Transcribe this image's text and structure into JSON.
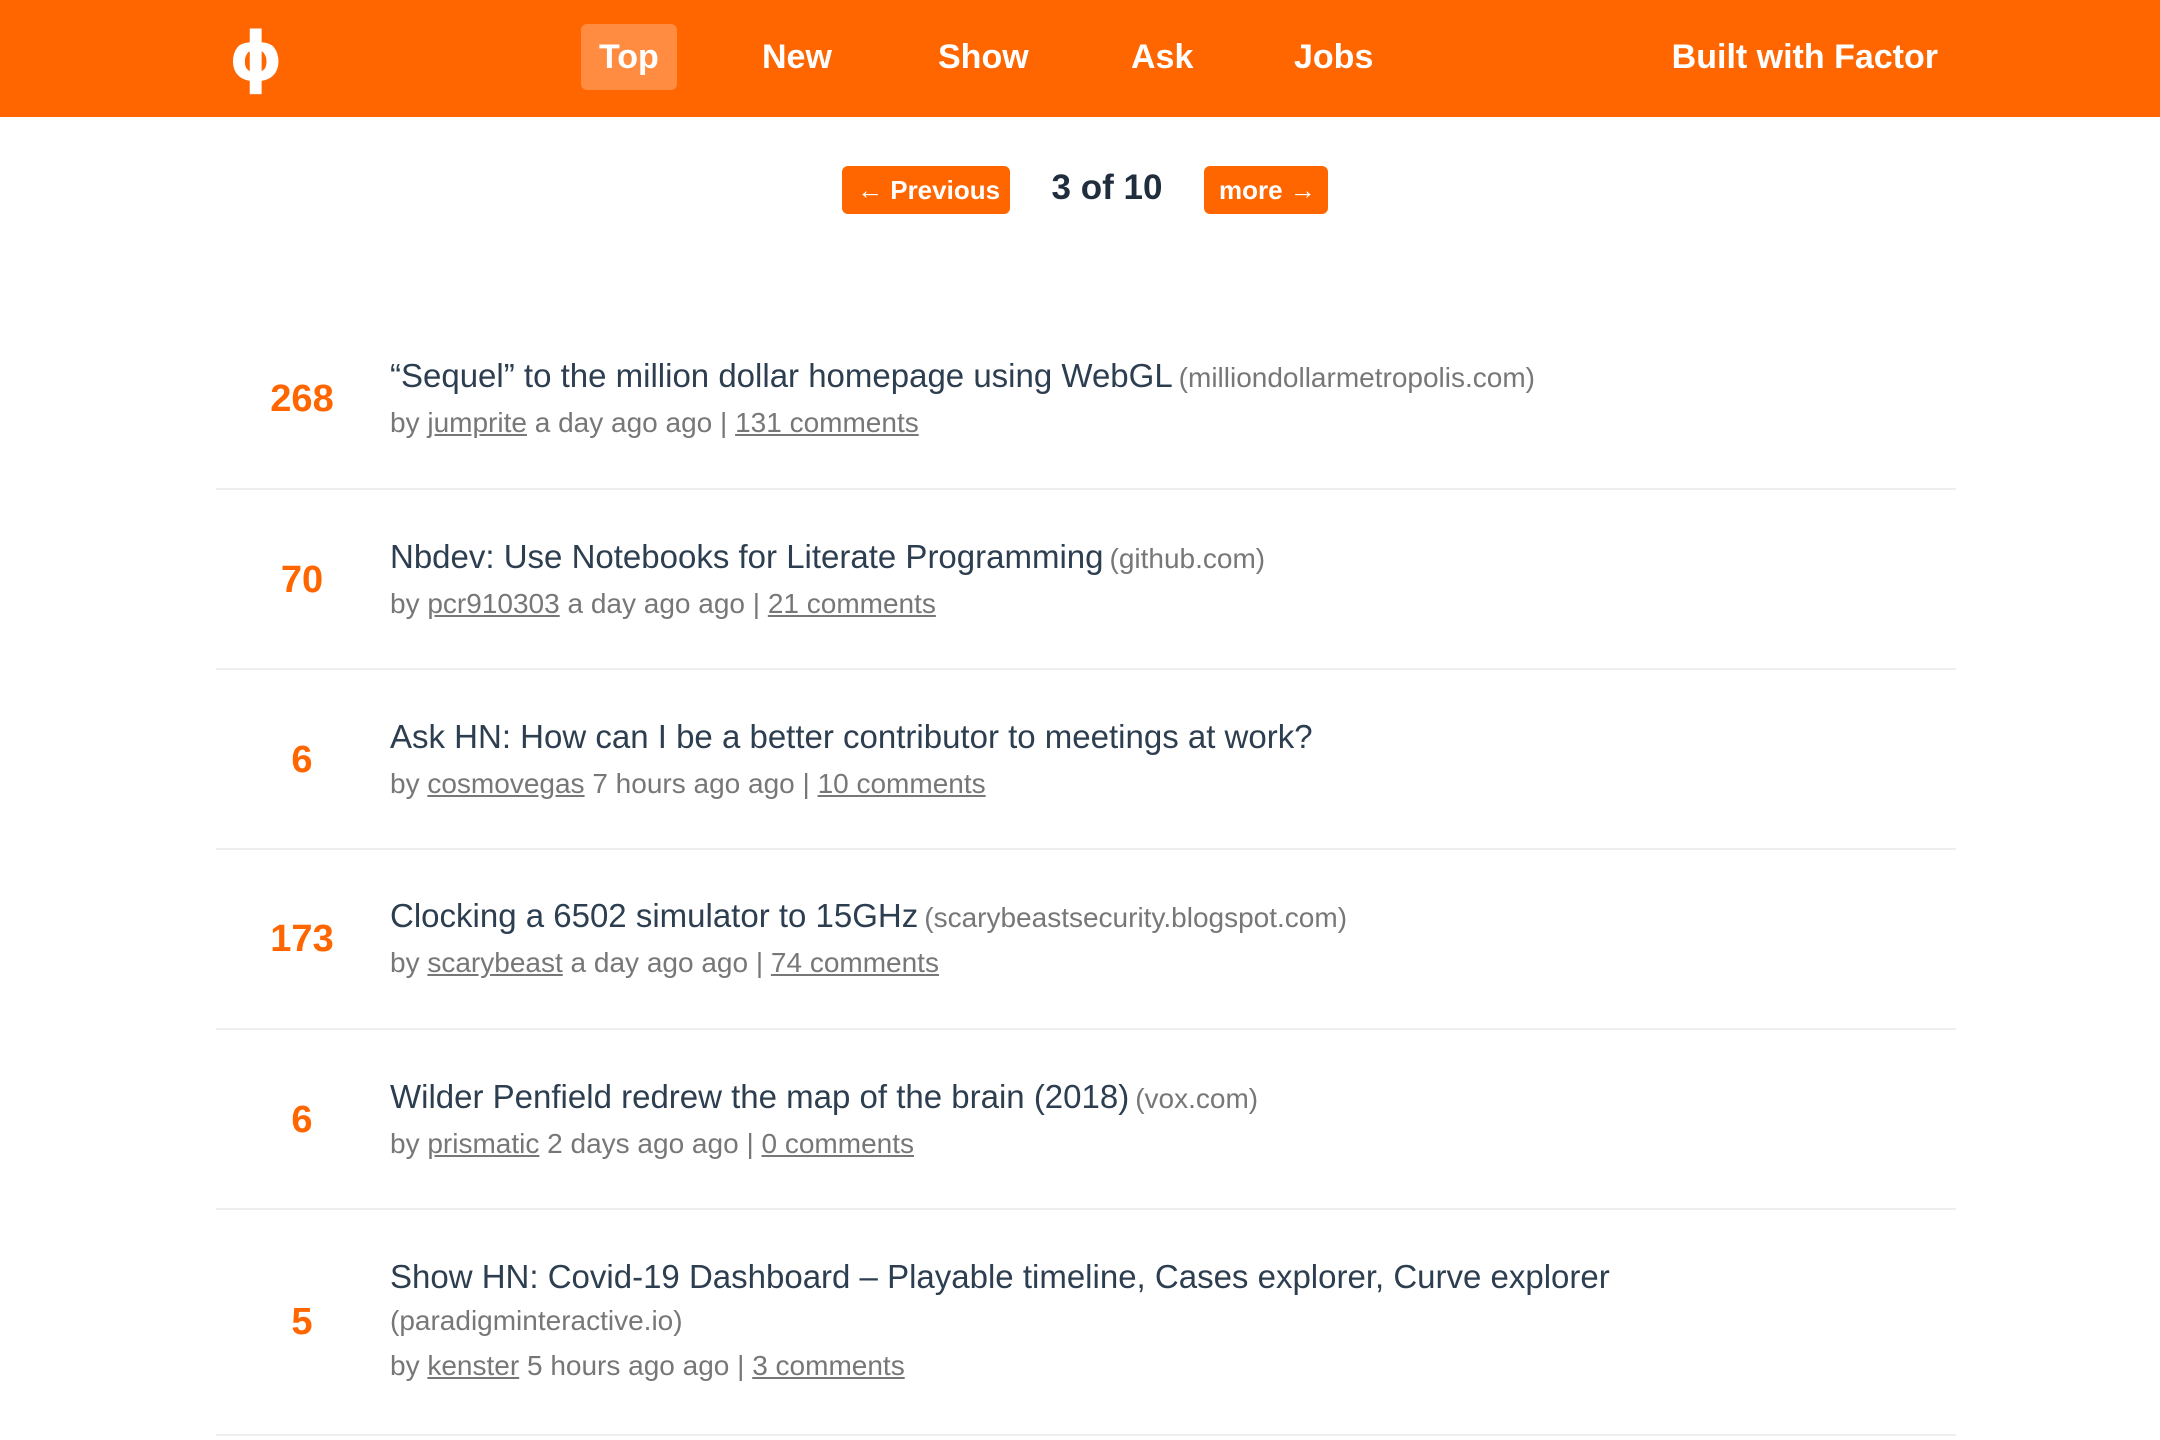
{
  "header": {
    "logo": "ɸ",
    "nav": [
      {
        "label": "Top",
        "active": true
      },
      {
        "label": "New",
        "active": false
      },
      {
        "label": "Show",
        "active": false
      },
      {
        "label": "Ask",
        "active": false
      },
      {
        "label": "Jobs",
        "active": false
      }
    ],
    "built_with": "Built with Factor"
  },
  "pagination": {
    "previous_label": "← Previous",
    "page_text": "3 of 10",
    "more_label": "more →"
  },
  "stories": [
    {
      "points": "268",
      "title": "“Sequel” to the million dollar homepage using WebGL",
      "domain": "(milliondollarmetropolis.com)",
      "by": "by",
      "user": "jumprite",
      "time": "a day ago ago",
      "sep": "|",
      "comments": "131 comments"
    },
    {
      "points": "70",
      "title": "Nbdev: Use Notebooks for Literate Programming",
      "domain": "(github.com)",
      "by": "by",
      "user": "pcr910303",
      "time": "a day ago ago",
      "sep": "|",
      "comments": "21 comments"
    },
    {
      "points": "6",
      "title": "Ask HN: How can I be a better contributor to meetings at work?",
      "domain": "",
      "by": "by",
      "user": "cosmovegas",
      "time": "7 hours ago ago",
      "sep": "|",
      "comments": "10 comments"
    },
    {
      "points": "173",
      "title": "Clocking a 6502 simulator to 15GHz",
      "domain": "(scarybeastsecurity.blogspot.com)",
      "by": "by",
      "user": "scarybeast",
      "time": "a day ago ago",
      "sep": "|",
      "comments": "74 comments"
    },
    {
      "points": "6",
      "title": "Wilder Penfield redrew the map of the brain (2018)",
      "domain": "(vox.com)",
      "by": "by",
      "user": "prismatic",
      "time": "2 days ago ago",
      "sep": "|",
      "comments": "0 comments"
    },
    {
      "points": "5",
      "title": "Show HN: Covid-19 Dashboard – Playable timeline, Cases explorer, Curve explorer",
      "domain": "(paradigminteractive.io)",
      "by": "by",
      "user": "kenster",
      "time": "5 hours ago ago",
      "sep": "|",
      "comments": "3 comments"
    }
  ]
}
